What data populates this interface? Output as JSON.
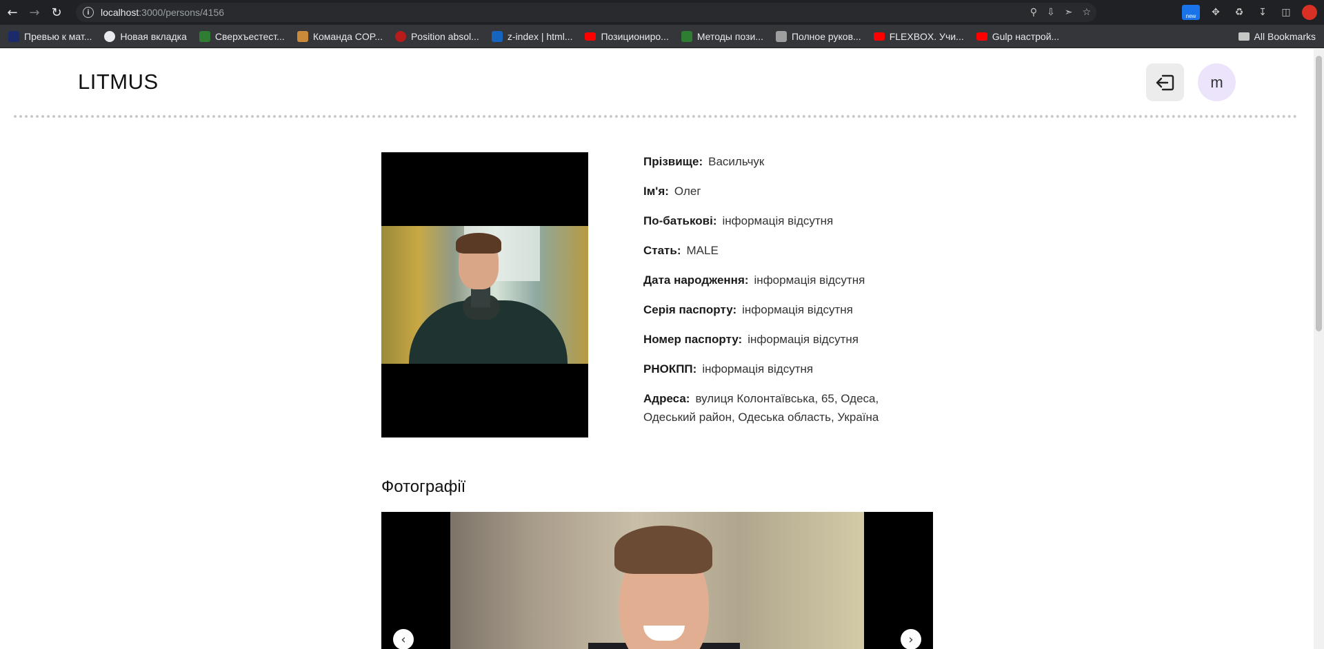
{
  "browser": {
    "url_host": "localhost",
    "url_path": ":3000/persons/4156",
    "bookmarks": [
      {
        "label": "Превью к мат...",
        "color": "#1b2a6b"
      },
      {
        "label": "Новая вкладка",
        "color": "#e8eaed"
      },
      {
        "label": "Сверхъестест...",
        "color": "#2e7d32"
      },
      {
        "label": "Команда COP...",
        "color": "#c98b3a"
      },
      {
        "label": "Position absol...",
        "color": "#b71c1c"
      },
      {
        "label": "z-index | html...",
        "color": "#1565c0"
      },
      {
        "label": "Позициониро...",
        "color": "#ff0000"
      },
      {
        "label": "Методы пози...",
        "color": "#2e7d32"
      },
      {
        "label": "Полное руков...",
        "color": "#9e9e9e"
      },
      {
        "label": "FLEXBOX. Учи...",
        "color": "#ff0000"
      },
      {
        "label": "Gulp настрой...",
        "color": "#ff0000"
      }
    ],
    "bookmarks_more": "»",
    "all_bookmarks": "All Bookmarks",
    "ext_new_label": "new"
  },
  "header": {
    "logo": "LITMUS",
    "avatar_letter": "m"
  },
  "person": {
    "fields": [
      {
        "label": "Прізвище:",
        "value": "Васильчук"
      },
      {
        "label": "Ім'я:",
        "value": "Олег"
      },
      {
        "label": "По-батькові:",
        "value": "інформація відсутня"
      },
      {
        "label": "Стать:",
        "value": "MALE"
      },
      {
        "label": "Дата народження:",
        "value": "інформація відсутня"
      },
      {
        "label": "Серія паспорту:",
        "value": "інформація відсутня"
      },
      {
        "label": "Номер паспорту:",
        "value": "інформація відсутня"
      },
      {
        "label": "РНОКПП:",
        "value": "інформація відсутня"
      },
      {
        "label": "Адреса:",
        "value": "вулиця Колонтаївська, 65, Одеса, Одеський район, Одеська область, Україна"
      }
    ]
  },
  "gallery": {
    "title": "Фотографії",
    "prev": "‹",
    "next": "›"
  }
}
